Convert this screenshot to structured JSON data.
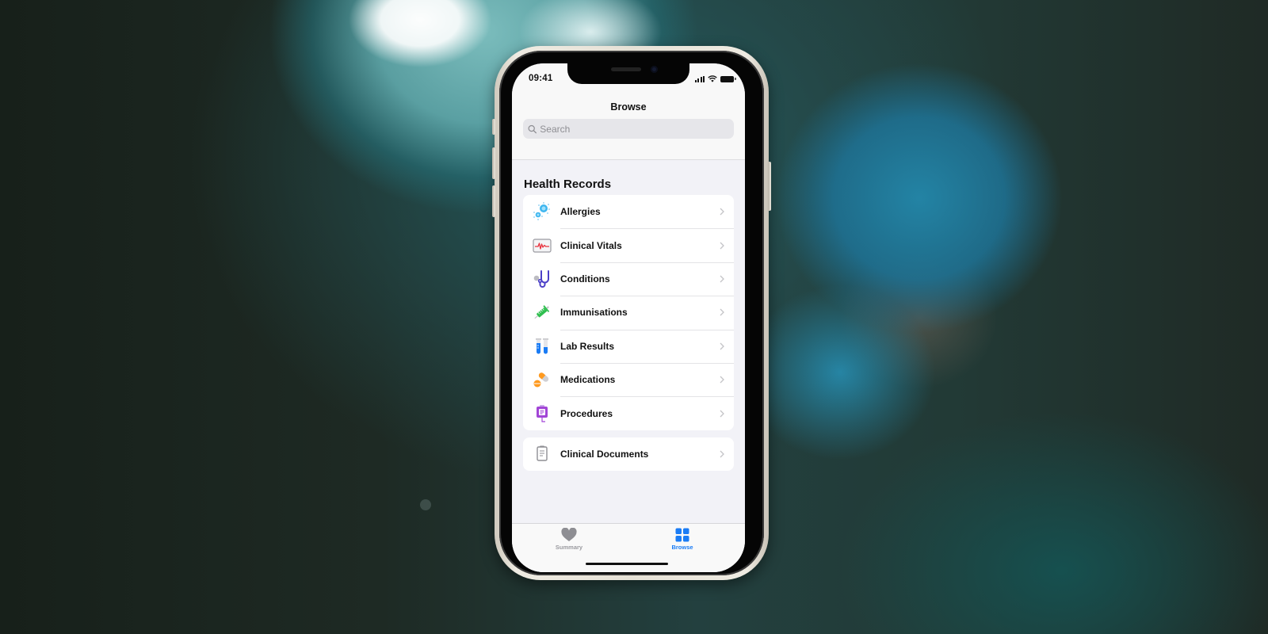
{
  "status_bar": {
    "time": "09:41",
    "icons": [
      "cellular-signal-icon",
      "wifi-icon",
      "battery-icon"
    ]
  },
  "navbar": {
    "title": "Browse",
    "search_placeholder": "Search",
    "search_value": ""
  },
  "health_records": {
    "section_title": "Health Records",
    "items": [
      {
        "label": "Allergies",
        "icon": "allergies-icon"
      },
      {
        "label": "Clinical Vitals",
        "icon": "clinical-vitals-icon"
      },
      {
        "label": "Conditions",
        "icon": "stethoscope-icon"
      },
      {
        "label": "Immunisations",
        "icon": "syringe-icon"
      },
      {
        "label": "Lab Results",
        "icon": "test-tubes-icon"
      },
      {
        "label": "Medications",
        "icon": "pills-icon"
      },
      {
        "label": "Procedures",
        "icon": "procedures-icon"
      }
    ]
  },
  "documents": {
    "items": [
      {
        "label": "Clinical Documents",
        "icon": "clipboard-icon"
      }
    ]
  },
  "tab_bar": {
    "tabs": [
      {
        "label": "Summary",
        "icon": "heart-icon",
        "active": false
      },
      {
        "label": "Browse",
        "icon": "grid-icon",
        "active": true
      }
    ]
  },
  "colors": {
    "accent": "#1a7cf5",
    "inactive": "#9a9a9f",
    "screen_bg": "#f2f2f7",
    "card_bg": "#ffffff"
  }
}
